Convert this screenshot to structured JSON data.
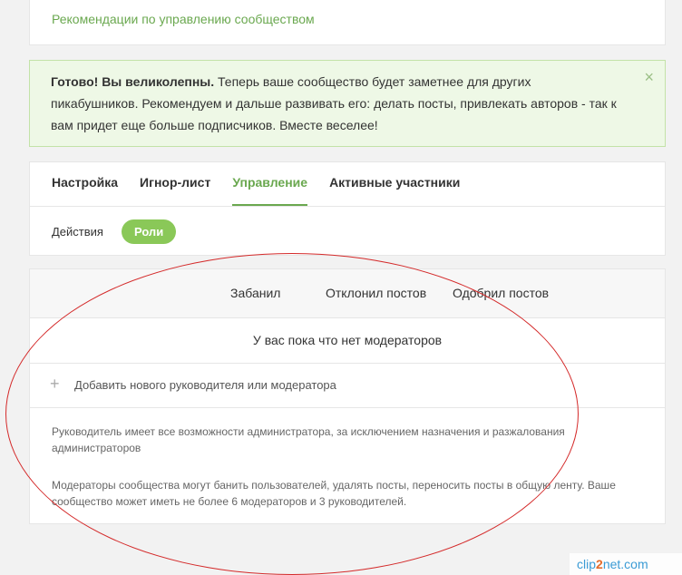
{
  "top": {
    "link": "Рекомендации по управлению сообществом"
  },
  "alert": {
    "bold": "Готово! Вы великолепны.",
    "text": " Теперь ваше сообщество будет заметнее для других пикабушников. Рекомендуем и дальше развивать его: делать посты, привлекать авторов - так к вам придет еще больше подписчиков. Вместе веселее!",
    "close": "×"
  },
  "tabs": [
    "Настройка",
    "Игнор-лист",
    "Управление",
    "Активные участники"
  ],
  "subtabs": {
    "actions": "Действия",
    "roles": "Роли"
  },
  "roles": {
    "columns": [
      "Забанил",
      "Отклонил постов",
      "Одобрил постов"
    ],
    "empty": "У вас пока что нет модераторов",
    "add_icon": "+",
    "add_label": "Добавить нового руководителя или модератора",
    "info1": "Руководитель имеет все возможности администратора, за исключением назначения и разжалования администраторов",
    "info2": "Модераторы сообщества могут банить пользователей, удалять посты, переносить посты в общую ленту. Ваше сообщество может иметь не более 6 модераторов и 3 руководителей."
  },
  "watermark": {
    "a": "clip",
    "b": "2",
    "c": "net.com"
  },
  "colors": {
    "accent": "#6aa84f",
    "pill": "#8ac858",
    "annotation": "#d42a2a"
  }
}
